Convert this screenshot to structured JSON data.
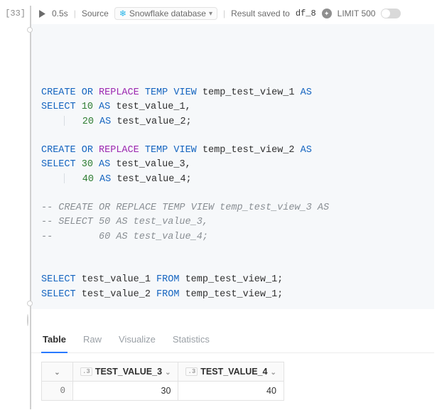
{
  "cell": {
    "exec_label": "[33]",
    "run_time": "0.5s",
    "source_label": "Source",
    "datasource": "Snowflake database",
    "result_saved_label": "Result saved to",
    "result_var": "df_8",
    "limit_label": "LIMIT 500"
  },
  "code": {
    "lines": [
      [
        {
          "t": "CREATE",
          "c": "kw-blue"
        },
        {
          "t": " "
        },
        {
          "t": "OR",
          "c": "kw-blue"
        },
        {
          "t": " "
        },
        {
          "t": "REPLACE",
          "c": "kw-purple"
        },
        {
          "t": " "
        },
        {
          "t": "TEMP",
          "c": "kw-blue"
        },
        {
          "t": " "
        },
        {
          "t": "VIEW",
          "c": "kw-blue"
        },
        {
          "t": " "
        },
        {
          "t": "temp_test_view_1",
          "c": "ident"
        },
        {
          "t": " "
        },
        {
          "t": "AS",
          "c": "kw-blue"
        }
      ],
      [
        {
          "t": "SELECT",
          "c": "kw-blue"
        },
        {
          "t": " "
        },
        {
          "t": "10",
          "c": "num"
        },
        {
          "t": " "
        },
        {
          "t": "AS",
          "c": "kw-blue"
        },
        {
          "t": " "
        },
        {
          "t": "test_value_1,",
          "c": "ident"
        }
      ],
      [
        {
          "t": "    ",
          "g": true
        },
        {
          "t": "   "
        },
        {
          "t": "20",
          "c": "num"
        },
        {
          "t": " "
        },
        {
          "t": "AS",
          "c": "kw-blue"
        },
        {
          "t": " "
        },
        {
          "t": "test_value_2;",
          "c": "ident"
        }
      ],
      [],
      [
        {
          "t": "CREATE",
          "c": "kw-blue"
        },
        {
          "t": " "
        },
        {
          "t": "OR",
          "c": "kw-blue"
        },
        {
          "t": " "
        },
        {
          "t": "REPLACE",
          "c": "kw-purple"
        },
        {
          "t": " "
        },
        {
          "t": "TEMP",
          "c": "kw-blue"
        },
        {
          "t": " "
        },
        {
          "t": "VIEW",
          "c": "kw-blue"
        },
        {
          "t": " "
        },
        {
          "t": "temp_test_view_2",
          "c": "ident"
        },
        {
          "t": " "
        },
        {
          "t": "AS",
          "c": "kw-blue"
        }
      ],
      [
        {
          "t": "SELECT",
          "c": "kw-blue"
        },
        {
          "t": " "
        },
        {
          "t": "30",
          "c": "num"
        },
        {
          "t": " "
        },
        {
          "t": "AS",
          "c": "kw-blue"
        },
        {
          "t": " "
        },
        {
          "t": "test_value_3,",
          "c": "ident"
        }
      ],
      [
        {
          "t": "    ",
          "g": true
        },
        {
          "t": "   "
        },
        {
          "t": "40",
          "c": "num"
        },
        {
          "t": " "
        },
        {
          "t": "AS",
          "c": "kw-blue"
        },
        {
          "t": " "
        },
        {
          "t": "test_value_4;",
          "c": "ident"
        }
      ],
      [],
      [
        {
          "t": "-- CREATE OR REPLACE TEMP VIEW temp_test_view_3 AS",
          "c": "comment"
        }
      ],
      [
        {
          "t": "-- SELECT 50 AS test_value_3,",
          "c": "comment"
        }
      ],
      [
        {
          "t": "--        60 AS test_value_4;",
          "c": "comment"
        }
      ],
      [],
      [],
      [
        {
          "t": "SELECT",
          "c": "kw-blue"
        },
        {
          "t": " "
        },
        {
          "t": "test_value_1",
          "c": "ident"
        },
        {
          "t": " "
        },
        {
          "t": "FROM",
          "c": "kw-blue"
        },
        {
          "t": " "
        },
        {
          "t": "temp_test_view_1;",
          "c": "ident"
        }
      ],
      [
        {
          "t": "SELECT",
          "c": "kw-blue"
        },
        {
          "t": " "
        },
        {
          "t": "test_value_2",
          "c": "ident"
        },
        {
          "t": " "
        },
        {
          "t": "FROM",
          "c": "kw-blue"
        },
        {
          "t": " "
        },
        {
          "t": "temp_test_view_1;",
          "c": "ident"
        }
      ]
    ]
  },
  "output": {
    "tabs": [
      "Table",
      "Raw",
      "Visualize",
      "Statistics"
    ],
    "active_tab": 0,
    "table": {
      "type_badge": ".3",
      "columns": [
        "TEST_VALUE_3",
        "TEST_VALUE_4"
      ],
      "rows": [
        {
          "idx": "0",
          "cells": [
            "30",
            "40"
          ]
        }
      ]
    }
  }
}
